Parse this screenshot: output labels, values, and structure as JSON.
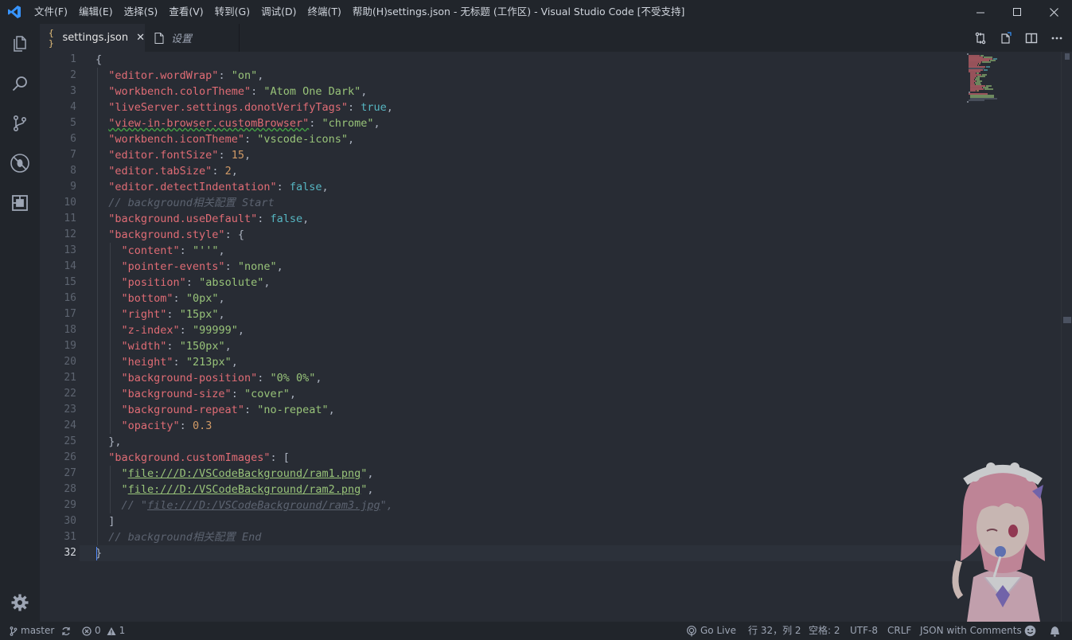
{
  "menu": [
    "文件(F)",
    "编辑(E)",
    "选择(S)",
    "查看(V)",
    "转到(G)",
    "调试(D)",
    "终端(T)",
    "帮助(H)"
  ],
  "window_title": "settings.json - 无标题 (工作区) - Visual Studio Code [不受支持]",
  "tabs": [
    {
      "icon": "{ }",
      "label": "settings.json",
      "active": true
    },
    {
      "label": "设置",
      "active": false
    }
  ],
  "editor": {
    "line_numbers": [
      "1",
      "2",
      "3",
      "4",
      "5",
      "6",
      "7",
      "8",
      "9",
      "10",
      "11",
      "12",
      "13",
      "14",
      "15",
      "16",
      "17",
      "18",
      "19",
      "20",
      "21",
      "22",
      "23",
      "24",
      "25",
      "26",
      "27",
      "28",
      "29",
      "30",
      "31",
      "32"
    ],
    "current_line": 32,
    "lines": [
      [
        {
          "t": "{",
          "c": "p"
        }
      ],
      [
        {
          "t": "  "
        },
        {
          "t": "\"editor.wordWrap\"",
          "c": "k"
        },
        {
          "t": ": "
        },
        {
          "t": "\"on\"",
          "c": "s"
        },
        {
          "t": ","
        }
      ],
      [
        {
          "t": "  "
        },
        {
          "t": "\"workbench.colorTheme\"",
          "c": "k"
        },
        {
          "t": ": "
        },
        {
          "t": "\"Atom One Dark\"",
          "c": "s"
        },
        {
          "t": ","
        }
      ],
      [
        {
          "t": "  "
        },
        {
          "t": "\"liveServer.settings.donotVerifyTags\"",
          "c": "k"
        },
        {
          "t": ": "
        },
        {
          "t": "true",
          "c": "b"
        },
        {
          "t": ","
        }
      ],
      [
        {
          "t": "  "
        },
        {
          "t": "\"view-in-browser.customBrowser\"",
          "c": "k sq"
        },
        {
          "t": ": "
        },
        {
          "t": "\"chrome\"",
          "c": "s"
        },
        {
          "t": ","
        }
      ],
      [
        {
          "t": "  "
        },
        {
          "t": "\"workbench.iconTheme\"",
          "c": "k"
        },
        {
          "t": ": "
        },
        {
          "t": "\"vscode-icons\"",
          "c": "s"
        },
        {
          "t": ","
        }
      ],
      [
        {
          "t": "  "
        },
        {
          "t": "\"editor.fontSize\"",
          "c": "k"
        },
        {
          "t": ": "
        },
        {
          "t": "15",
          "c": "n"
        },
        {
          "t": ","
        }
      ],
      [
        {
          "t": "  "
        },
        {
          "t": "\"editor.tabSize\"",
          "c": "k"
        },
        {
          "t": ": "
        },
        {
          "t": "2",
          "c": "n"
        },
        {
          "t": ","
        }
      ],
      [
        {
          "t": "  "
        },
        {
          "t": "\"editor.detectIndentation\"",
          "c": "k"
        },
        {
          "t": ": "
        },
        {
          "t": "false",
          "c": "b"
        },
        {
          "t": ","
        }
      ],
      [
        {
          "t": "  "
        },
        {
          "t": "// background相关配置 Start",
          "c": "c"
        }
      ],
      [
        {
          "t": "  "
        },
        {
          "t": "\"background.useDefault\"",
          "c": "k"
        },
        {
          "t": ": "
        },
        {
          "t": "false",
          "c": "b"
        },
        {
          "t": ","
        }
      ],
      [
        {
          "t": "  "
        },
        {
          "t": "\"background.style\"",
          "c": "k"
        },
        {
          "t": ": {"
        }
      ],
      [
        {
          "t": "    "
        },
        {
          "t": "\"content\"",
          "c": "k"
        },
        {
          "t": ": "
        },
        {
          "t": "\"''\"",
          "c": "s"
        },
        {
          "t": ","
        }
      ],
      [
        {
          "t": "    "
        },
        {
          "t": "\"pointer-events\"",
          "c": "k"
        },
        {
          "t": ": "
        },
        {
          "t": "\"none\"",
          "c": "s"
        },
        {
          "t": ","
        }
      ],
      [
        {
          "t": "    "
        },
        {
          "t": "\"position\"",
          "c": "k"
        },
        {
          "t": ": "
        },
        {
          "t": "\"absolute\"",
          "c": "s"
        },
        {
          "t": ","
        }
      ],
      [
        {
          "t": "    "
        },
        {
          "t": "\"bottom\"",
          "c": "k"
        },
        {
          "t": ": "
        },
        {
          "t": "\"0px\"",
          "c": "s"
        },
        {
          "t": ","
        }
      ],
      [
        {
          "t": "    "
        },
        {
          "t": "\"right\"",
          "c": "k"
        },
        {
          "t": ": "
        },
        {
          "t": "\"15px\"",
          "c": "s"
        },
        {
          "t": ","
        }
      ],
      [
        {
          "t": "    "
        },
        {
          "t": "\"z-index\"",
          "c": "k"
        },
        {
          "t": ": "
        },
        {
          "t": "\"99999\"",
          "c": "s"
        },
        {
          "t": ","
        }
      ],
      [
        {
          "t": "    "
        },
        {
          "t": "\"width\"",
          "c": "k"
        },
        {
          "t": ": "
        },
        {
          "t": "\"150px\"",
          "c": "s"
        },
        {
          "t": ","
        }
      ],
      [
        {
          "t": "    "
        },
        {
          "t": "\"height\"",
          "c": "k"
        },
        {
          "t": ": "
        },
        {
          "t": "\"213px\"",
          "c": "s"
        },
        {
          "t": ","
        }
      ],
      [
        {
          "t": "    "
        },
        {
          "t": "\"background-position\"",
          "c": "k"
        },
        {
          "t": ": "
        },
        {
          "t": "\"0% 0%\"",
          "c": "s"
        },
        {
          "t": ","
        }
      ],
      [
        {
          "t": "    "
        },
        {
          "t": "\"background-size\"",
          "c": "k"
        },
        {
          "t": ": "
        },
        {
          "t": "\"cover\"",
          "c": "s"
        },
        {
          "t": ","
        }
      ],
      [
        {
          "t": "    "
        },
        {
          "t": "\"background-repeat\"",
          "c": "k"
        },
        {
          "t": ": "
        },
        {
          "t": "\"no-repeat\"",
          "c": "s"
        },
        {
          "t": ","
        }
      ],
      [
        {
          "t": "    "
        },
        {
          "t": "\"opacity\"",
          "c": "k"
        },
        {
          "t": ": "
        },
        {
          "t": "0.3",
          "c": "n"
        }
      ],
      [
        {
          "t": "  },"
        }
      ],
      [
        {
          "t": "  "
        },
        {
          "t": "\"background.customImages\"",
          "c": "k"
        },
        {
          "t": ": ["
        }
      ],
      [
        {
          "t": "    "
        },
        {
          "t": "\"",
          "c": "s"
        },
        {
          "t": "file:///D:/VSCodeBackground/ram1.png",
          "c": "s u"
        },
        {
          "t": "\"",
          "c": "s"
        },
        {
          "t": ","
        }
      ],
      [
        {
          "t": "    "
        },
        {
          "t": "\"",
          "c": "s"
        },
        {
          "t": "file:///D:/VSCodeBackground/ram2.png",
          "c": "s u"
        },
        {
          "t": "\"",
          "c": "s"
        },
        {
          "t": ","
        }
      ],
      [
        {
          "t": "    "
        },
        {
          "t": "// \"",
          "c": "c"
        },
        {
          "t": "file:///D:/VSCodeBackground/ram3.jpg",
          "c": "c u"
        },
        {
          "t": "\",",
          "c": "c"
        }
      ],
      [
        {
          "t": "  ]"
        }
      ],
      [
        {
          "t": "  "
        },
        {
          "t": "// background相关配置 End",
          "c": "c"
        }
      ],
      [
        {
          "t": "}",
          "c": "p"
        }
      ]
    ]
  },
  "status": {
    "branch": "master",
    "errors": "0",
    "warnings": "1",
    "go_live": "Go Live",
    "cursor": "行 32，列 2",
    "indent": "空格: 2",
    "encoding": "UTF-8",
    "eol": "CRLF",
    "language": "JSON with Comments"
  },
  "colors": {
    "accent": "#3794ff",
    "string": "#98c379",
    "key": "#e06c75",
    "keyword": "#56b6c2",
    "number": "#d19a66",
    "comment": "#5c6370"
  }
}
